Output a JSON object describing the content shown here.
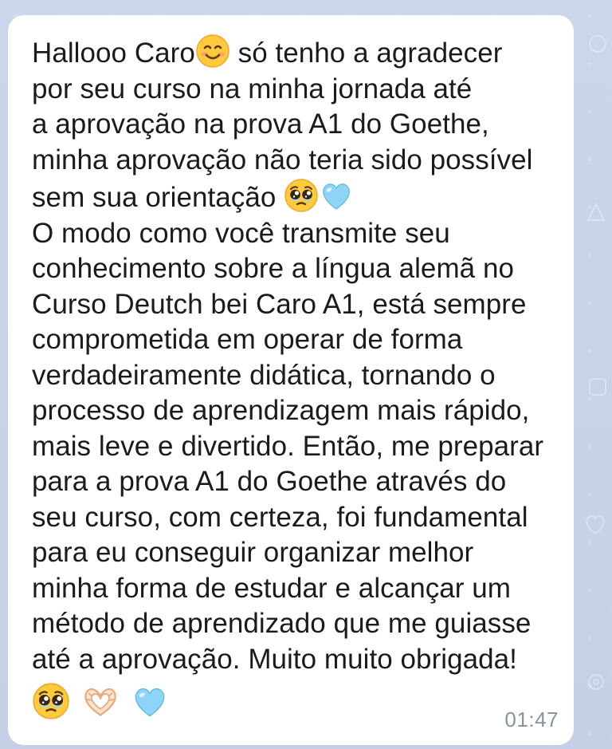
{
  "message": {
    "lines": [
      {
        "before": "Hallooo Caro",
        "emoji": "smiling-face-icon",
        "after": " só tenho a agradecer"
      },
      {
        "text": "por seu curso na minha jornada até"
      },
      {
        "text": "a aprovação na prova A1 do Goethe,"
      },
      {
        "text": "minha aprovação não teria sido possível"
      },
      {
        "text": "sem sua orientação "
      },
      {
        "text": "O modo como você transmite seu"
      },
      {
        "text": "conhecimento sobre a língua alemã no"
      },
      {
        "text": "Curso Deutch bei Caro A1, está sempre"
      },
      {
        "text": "comprometida em operar de forma"
      },
      {
        "text": "verdadeiramente didática, tornando o"
      },
      {
        "text": "processo de aprendizagem mais rápido,"
      },
      {
        "text": "mais leve e divertido. Então, me preparar"
      },
      {
        "text": "para a prova A1 do Goethe através do"
      },
      {
        "text": "seu curso, com certeza, foi fundamental"
      },
      {
        "text": "para eu conseguir organizar melhor"
      },
      {
        "text": "minha forma de estudar e alcançar um"
      },
      {
        "text": "método de aprendizado que me guiasse"
      },
      {
        "text": "até a aprovação. Muito muito obrigada!"
      }
    ],
    "icons": {
      "line5": [
        "pleading-face-icon",
        "light-blue-heart-icon"
      ],
      "final_row": [
        "pleading-face-icon",
        "heart-hands-icon",
        "light-blue-heart-icon"
      ]
    },
    "time": "01:47"
  },
  "colors": {
    "background": "#c7d3e8",
    "bubble": "#ffffff",
    "text": "#1b1b1b",
    "timestamp": "#8a939c",
    "blue_heart": "#8fd3f6"
  }
}
